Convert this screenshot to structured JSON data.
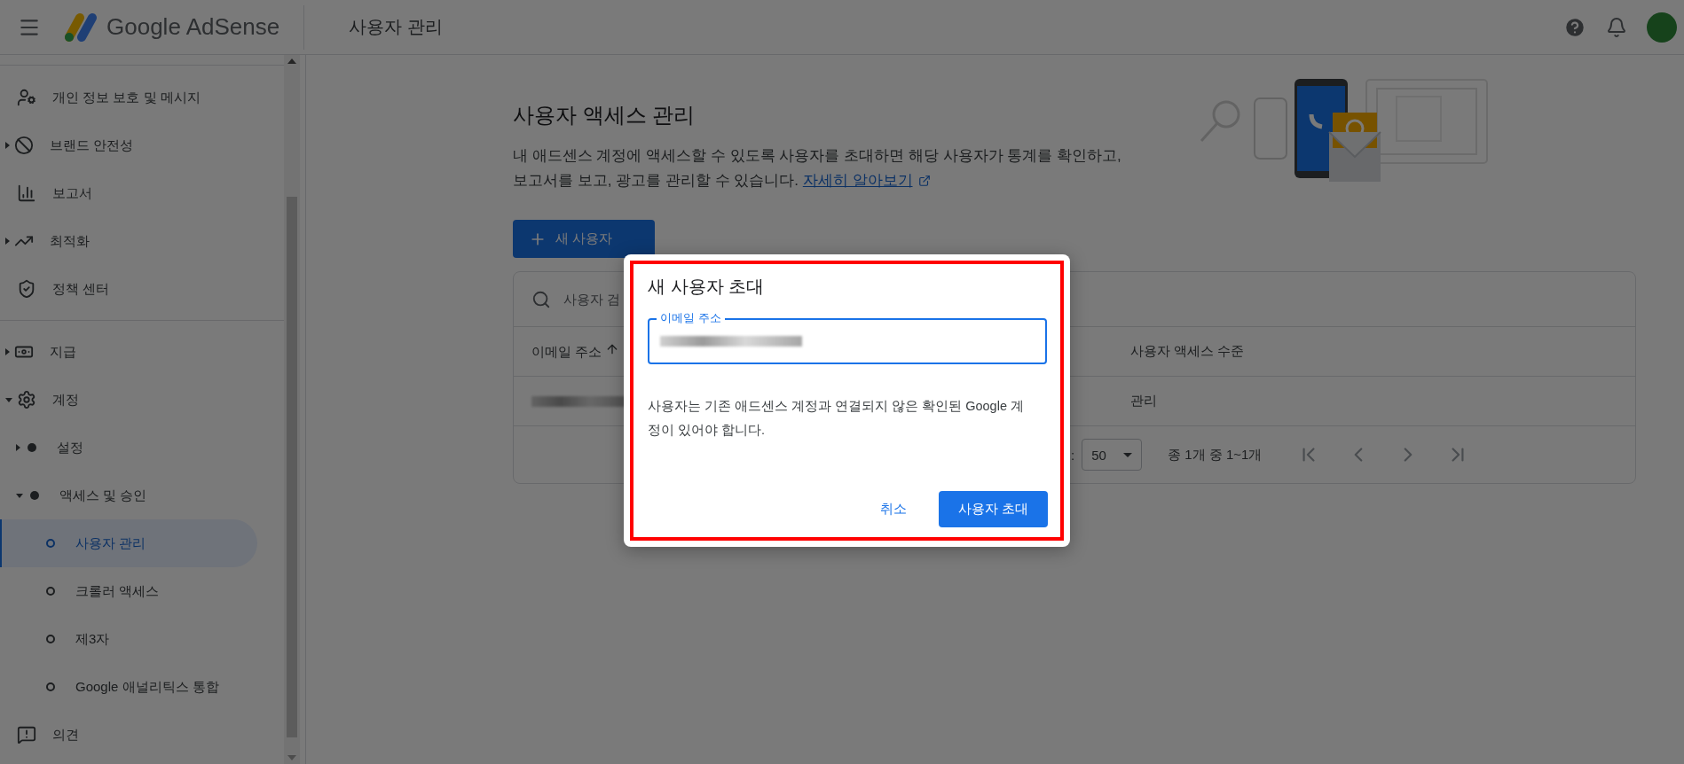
{
  "header": {
    "product": "Google AdSense",
    "page_title": "사용자 관리"
  },
  "sidebar": {
    "sections": [
      {
        "items": [
          {
            "label": "개인 정보 보호 및 메시지",
            "selected": false
          },
          {
            "label": "브랜드 안전성",
            "expanded": false,
            "selected": false
          },
          {
            "label": "보고서",
            "selected": false
          },
          {
            "label": "최적화",
            "expanded": false,
            "selected": false
          },
          {
            "label": "정책 센터",
            "selected": false
          }
        ]
      },
      {
        "items": [
          {
            "label": "지급",
            "expanded": false,
            "selected": false
          },
          {
            "label": "계정",
            "expanded": true,
            "selected": false,
            "children": [
              {
                "label": "설정",
                "expanded": false,
                "selected": false
              },
              {
                "label": "액세스 및 승인",
                "expanded": true,
                "selected": false,
                "children": [
                  {
                    "label": "사용자 관리",
                    "selected": true
                  },
                  {
                    "label": "크롤러 액세스",
                    "selected": false
                  },
                  {
                    "label": "제3자",
                    "selected": false
                  },
                  {
                    "label": "Google 애널리틱스 통합",
                    "selected": false
                  }
                ]
              }
            ]
          },
          {
            "label": "의견",
            "selected": false
          }
        ]
      }
    ]
  },
  "page": {
    "title": "사용자 액세스 관리",
    "description": "내 애드센스 계정에 액세스할 수 있도록 사용자를 초대하면 해당 사용자가 통계를 확인하고, 보고서를 보고, 광고를 관리할 수 있습니다.",
    "learn_more": "자세히 알아보기",
    "new_user_button": "새 사용자"
  },
  "table": {
    "search": {
      "placeholder": "사용자 검"
    },
    "columns": [
      "이메일 주소",
      "사용자 액세스 수준"
    ],
    "rows": [
      {
        "access": "관리"
      }
    ],
    "footer": {
      "rows_label": ":",
      "page_size": "50",
      "range": "종 1개 중 1~1개"
    }
  },
  "dialog": {
    "title": "새 사용자 초대",
    "field_label": "이메일 주소",
    "note": "사용자는 기존 애드센스 계정과 연결되지 않은 확인된 Google 계정이 있어야 합니다.",
    "cancel": "취소",
    "confirm": "사용자 초대"
  }
}
